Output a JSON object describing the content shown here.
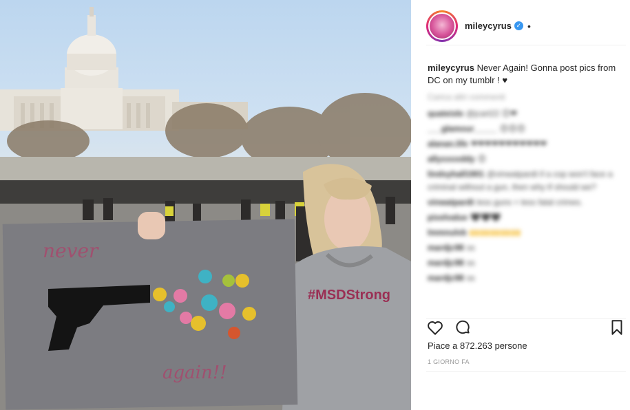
{
  "post": {
    "username": "mileycyrus",
    "verified_mark": "✓",
    "header_dot": "•",
    "caption_user": "mileycyrus",
    "caption_text": "Never Again! Gonna post pics from DC on my tumblr ! ♥",
    "load_more": "Carica altri commenti",
    "comments": [
      {
        "user": "quateisle",
        "text": "@jcart22 😊❤"
      },
      {
        "user": "___glamour_____",
        "text": "😍😍😍"
      },
      {
        "user": "alanan.life",
        "text": "❤❤❤❤❤❤❤❤❤❤❤"
      },
      {
        "user": "allyxxoxddy",
        "text": "😍"
      },
      {
        "user": "lindsyhall1901",
        "text": "@vinwatpardt if a cop won't face a criminal without a gun, then why tf should we?"
      },
      {
        "user": "vinwatpardt",
        "text": "less guns = less fatal crimes."
      },
      {
        "user": "pixelvalue",
        "text": "🖤🖤🖤"
      },
      {
        "user": "lmmnulvb",
        "text": "🙌🙌🙌🙌🙌"
      },
      {
        "user": "mardjc98",
        "text": "ss"
      },
      {
        "user": "mardjc98",
        "text": "ss"
      },
      {
        "user": "mardjc98",
        "text": "ss"
      }
    ],
    "likes_text": "Piace a 872.263 persone",
    "timestamp": "1 GIORNO FA",
    "icons": [
      "heart-icon",
      "comment-icon",
      "bookmark-icon"
    ],
    "colors": {
      "verified": "#3897f0",
      "text": "#262626",
      "muted": "#999999"
    }
  },
  "photo": {
    "sign_top_text": "never",
    "sign_bottom_text": "again!!",
    "shirt_text": "#MSDStrong"
  }
}
